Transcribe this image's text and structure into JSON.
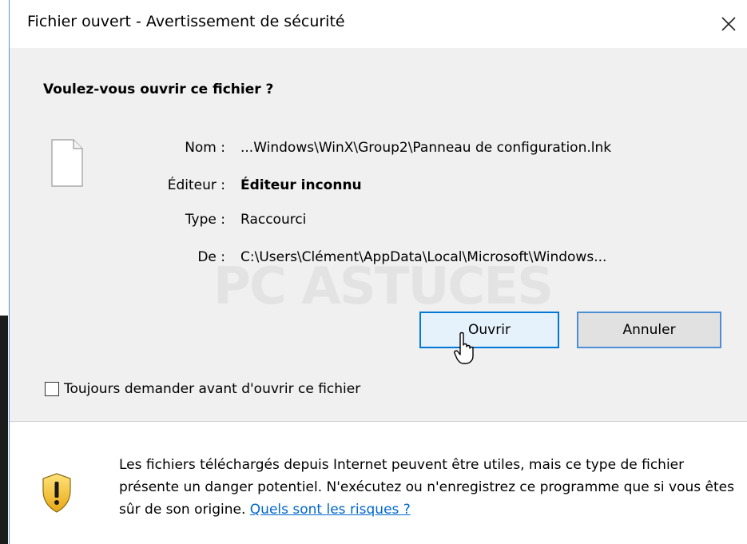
{
  "window": {
    "title": "Fichier ouvert - Avertissement de sécurité"
  },
  "dialog": {
    "heading": "Voulez-vous ouvrir ce fichier ?",
    "info": [
      {
        "label": "Nom :",
        "value": "...Windows\\WinX\\Group2\\Panneau de configuration.lnk",
        "bold": false
      },
      {
        "label": "Éditeur :",
        "value": "Éditeur inconnu",
        "bold": true
      },
      {
        "label": "Type :",
        "value": "Raccourci",
        "bold": false
      },
      {
        "label": "De :",
        "value": "C:\\Users\\Clément\\AppData\\Local\\Microsoft\\Windows...",
        "bold": false
      }
    ],
    "open_label": "Ouvrir",
    "cancel_label": "Annuler",
    "always_ask_label": "Toujours demander avant d'ouvrir ce fichier",
    "always_ask_checked": false
  },
  "warning": {
    "text": "Les fichiers téléchargés depuis Internet peuvent être utiles, mais ce type de fichier présente un danger potentiel. N'exécutez ou n'enregistrez ce programme que si vous êtes sûr de son origine.",
    "link_label": "Quels sont les risques ?"
  },
  "watermark": {
    "text": "PC ASTUCES"
  },
  "icons": {
    "file": "file-icon",
    "close": "close-icon",
    "shield": "shield-warning-icon",
    "cursor": "mouse-cursor-icon"
  },
  "colors": {
    "accent": "#0078d7",
    "link": "#0066cc",
    "shield_yellow": "#f5c22a",
    "dialog_bg": "#f0f0f0"
  }
}
